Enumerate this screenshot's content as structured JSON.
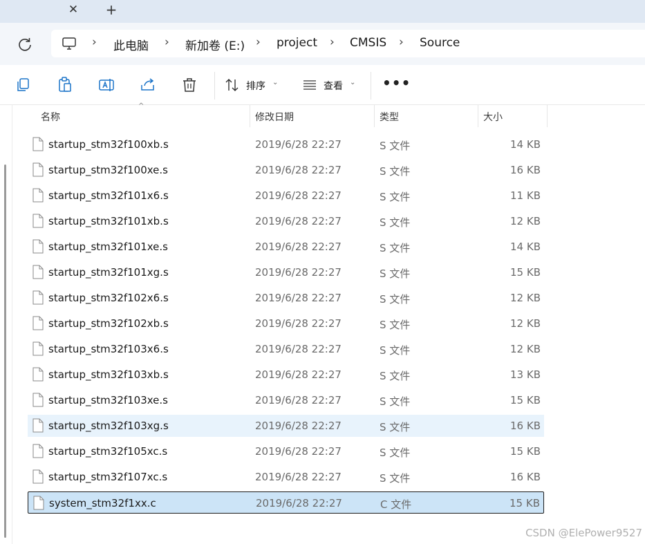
{
  "tabs": {
    "close_glyph": "✕",
    "new_glyph": "+"
  },
  "breadcrumb": {
    "items": [
      "此电脑",
      "新加卷 (E:)",
      "project",
      "CMSIS",
      "Source"
    ],
    "separator": "›"
  },
  "toolbar": {
    "sort_label": "排序",
    "view_label": "查看",
    "more_label": "•••",
    "caret": "⌄"
  },
  "columns": {
    "name": "名称",
    "modified": "修改日期",
    "type": "类型",
    "size": "大小"
  },
  "files": [
    {
      "name": "startup_stm32f100xb.s",
      "date": "2019/6/28 22:27",
      "type": "S 文件",
      "size": "14 KB"
    },
    {
      "name": "startup_stm32f100xe.s",
      "date": "2019/6/28 22:27",
      "type": "S 文件",
      "size": "16 KB"
    },
    {
      "name": "startup_stm32f101x6.s",
      "date": "2019/6/28 22:27",
      "type": "S 文件",
      "size": "11 KB"
    },
    {
      "name": "startup_stm32f101xb.s",
      "date": "2019/6/28 22:27",
      "type": "S 文件",
      "size": "12 KB"
    },
    {
      "name": "startup_stm32f101xe.s",
      "date": "2019/6/28 22:27",
      "type": "S 文件",
      "size": "14 KB"
    },
    {
      "name": "startup_stm32f101xg.s",
      "date": "2019/6/28 22:27",
      "type": "S 文件",
      "size": "15 KB"
    },
    {
      "name": "startup_stm32f102x6.s",
      "date": "2019/6/28 22:27",
      "type": "S 文件",
      "size": "12 KB"
    },
    {
      "name": "startup_stm32f102xb.s",
      "date": "2019/6/28 22:27",
      "type": "S 文件",
      "size": "12 KB"
    },
    {
      "name": "startup_stm32f103x6.s",
      "date": "2019/6/28 22:27",
      "type": "S 文件",
      "size": "12 KB"
    },
    {
      "name": "startup_stm32f103xb.s",
      "date": "2019/6/28 22:27",
      "type": "S 文件",
      "size": "13 KB"
    },
    {
      "name": "startup_stm32f103xe.s",
      "date": "2019/6/28 22:27",
      "type": "S 文件",
      "size": "15 KB"
    },
    {
      "name": "startup_stm32f103xg.s",
      "date": "2019/6/28 22:27",
      "type": "S 文件",
      "size": "16 KB"
    },
    {
      "name": "startup_stm32f105xc.s",
      "date": "2019/6/28 22:27",
      "type": "S 文件",
      "size": "15 KB"
    },
    {
      "name": "startup_stm32f107xc.s",
      "date": "2019/6/28 22:27",
      "type": "S 文件",
      "size": "16 KB"
    },
    {
      "name": "system_stm32f1xx.c",
      "date": "2019/6/28 22:27",
      "type": "C 文件",
      "size": "15 KB"
    }
  ],
  "watermark": "CSDN @ElePower9527",
  "colors": {
    "tabstrip": "#dfe8f3",
    "hover_row": "#e8f3fc",
    "selected_row": "#cce4f7",
    "accent": "#1a73c8"
  }
}
